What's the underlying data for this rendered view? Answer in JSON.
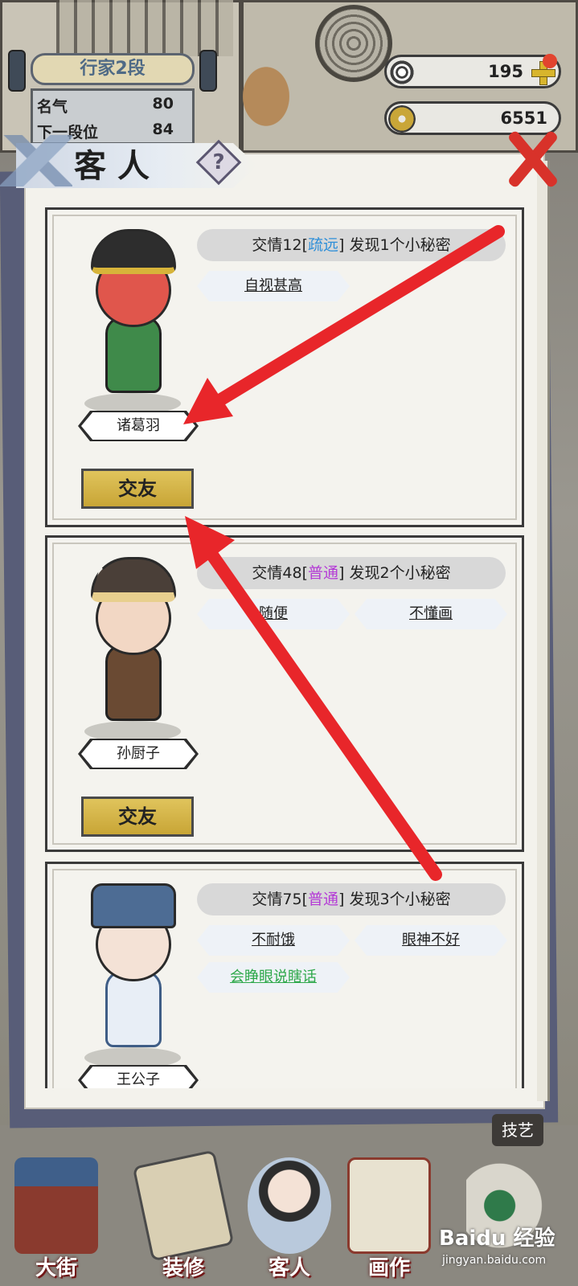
{
  "rank": {
    "title": "行家2段",
    "fame_label": "名气",
    "fame_value": "80",
    "next_label": "下一段位",
    "next_value": "84"
  },
  "currency": {
    "primary_value": "195",
    "coins_value": "6551"
  },
  "dialog": {
    "title": "客人",
    "help_label": "?"
  },
  "guests": [
    {
      "name": "诸葛羽",
      "affinity_prefix": "交情12[",
      "affinity_level": "疏远",
      "affinity_suffix": "] 发现1个小秘密",
      "traits": [
        "自视甚高"
      ],
      "action_label": "交友"
    },
    {
      "name": "孙厨子",
      "affinity_prefix": "交情48[",
      "affinity_level": "普通",
      "affinity_suffix": "] 发现2个小秘密",
      "traits": [
        "随便",
        "不懂画"
      ],
      "action_label": "交友"
    },
    {
      "name": "王公子",
      "affinity_prefix": "交情75[",
      "affinity_level": "普通",
      "affinity_suffix": "] 发现3个小秘密",
      "traits": [
        "不耐饿",
        "眼神不好",
        "会睁眼说瞎话"
      ]
    }
  ],
  "bottom_nav": {
    "street": "大街",
    "decorate": "装修",
    "guests": "客人",
    "painting": "画作",
    "skills": "技艺"
  },
  "watermark": {
    "main": "Baidu 经验",
    "sub": "jingyan.baidu.com"
  },
  "colors": {
    "accent_red": "#e8262a",
    "level_distant": "#2f8fd8",
    "level_normal": "#b43ad6",
    "trait_positive": "#2ea84a",
    "button_gold": "#d4b548"
  }
}
